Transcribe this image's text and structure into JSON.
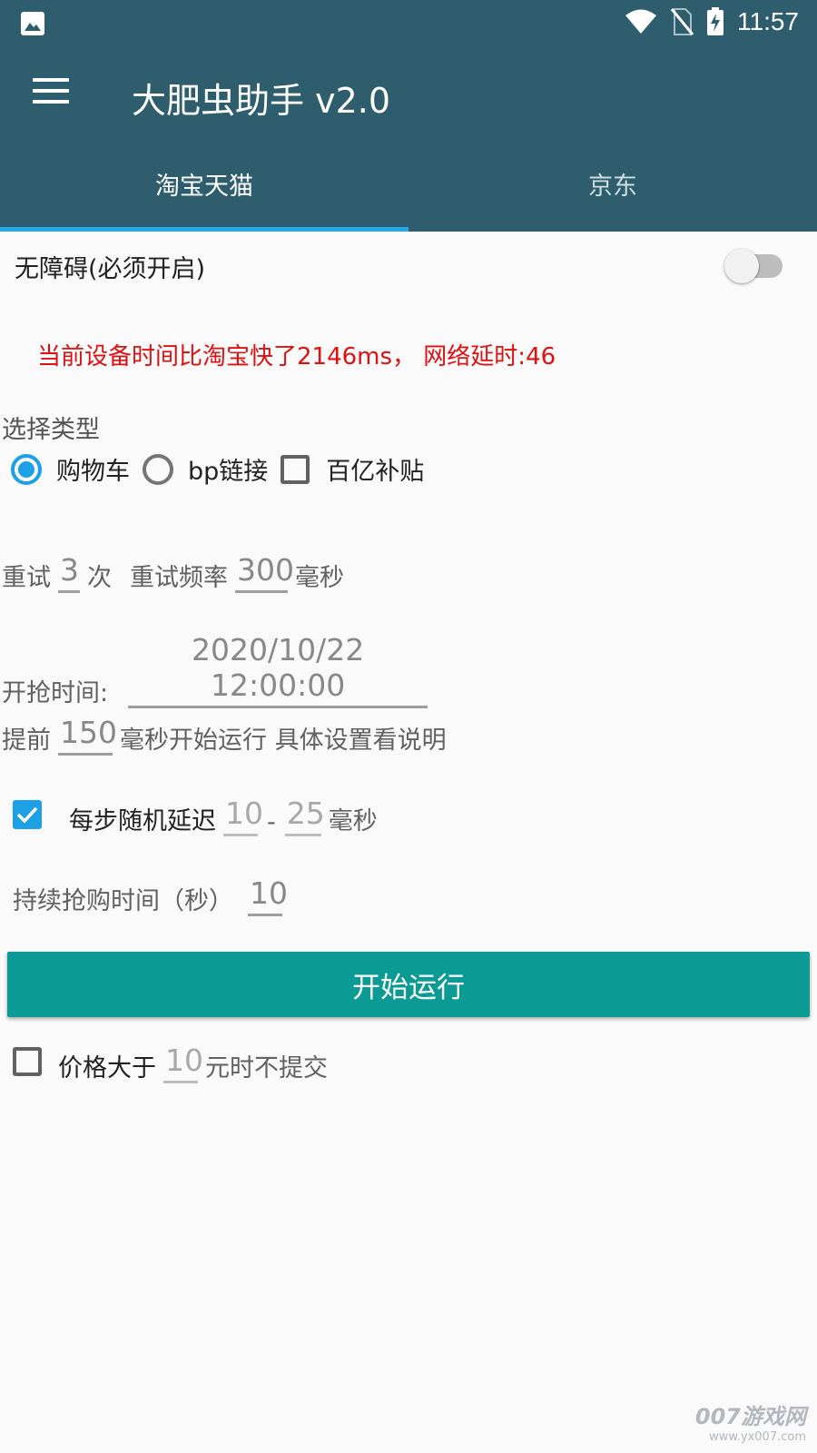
{
  "status_bar": {
    "time": "11:57"
  },
  "app": {
    "title": "大肥虫助手 v2.0"
  },
  "tabs": [
    {
      "label": "淘宝天猫",
      "active": true
    },
    {
      "label": "京东",
      "active": false
    }
  ],
  "accessibility": {
    "label": "无障碍(必须开启)",
    "enabled": false
  },
  "time_warning": "当前设备时间比淘宝快了2146ms， 网络延时:46",
  "type_select": {
    "label": "选择类型",
    "options": [
      {
        "label": "购物车",
        "kind": "radio",
        "selected": true
      },
      {
        "label": "bp链接",
        "kind": "radio",
        "selected": false
      },
      {
        "label": "百亿补贴",
        "kind": "checkbox",
        "checked": false
      }
    ]
  },
  "retry": {
    "label": "重试",
    "count": "3",
    "count_unit": "次",
    "freq_label": "重试频率",
    "freq": "300",
    "freq_unit": "毫秒"
  },
  "start_time": {
    "label": "开抢时间:",
    "value": "2020/10/22 12:00:00"
  },
  "advance": {
    "label": "提前",
    "value": "150",
    "suffix": "毫秒开始运行 具体设置看说明"
  },
  "random_delay": {
    "checked": true,
    "label": "每步随机延迟",
    "min": "10",
    "separator": "-",
    "max": "25",
    "unit": "毫秒"
  },
  "duration": {
    "label": "持续抢购时间（秒）",
    "value": "10"
  },
  "start_button": {
    "label": "开始运行"
  },
  "price_limit": {
    "checked": false,
    "label": "价格大于",
    "value": "10",
    "suffix": "元时不提交"
  },
  "watermark": {
    "brand": "007游戏网",
    "url": "www.yx007.com"
  },
  "colors": {
    "primary": "#2e5e6e",
    "accent": "#1ea0e6",
    "button": "#0c9b94",
    "warning": "#e01010"
  }
}
